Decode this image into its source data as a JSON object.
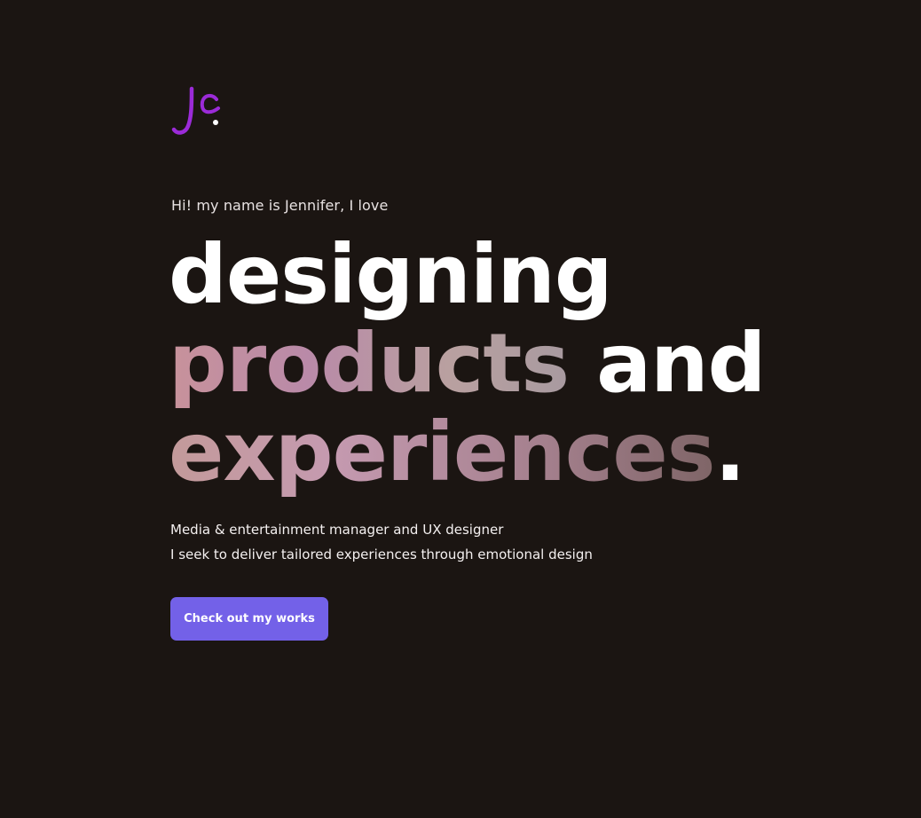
{
  "brand": {
    "logo_text": "Jc",
    "logo_color": "#9b2bd8"
  },
  "hero": {
    "intro": "Hi! my name is Jennifer, I love",
    "line1": "designing",
    "line2_highlight": "products",
    "line2_rest": " and",
    "line3_highlight": "experiences",
    "line3_period": ".",
    "tagline_1": "Media & entertainment manager and UX designer",
    "tagline_2": "I seek to deliver tailored experiences through emotional design"
  },
  "cta": {
    "label": "Check out my works",
    "color": "#7361e8"
  },
  "colors": {
    "background": "#1b1512",
    "text": "#ffffff"
  }
}
